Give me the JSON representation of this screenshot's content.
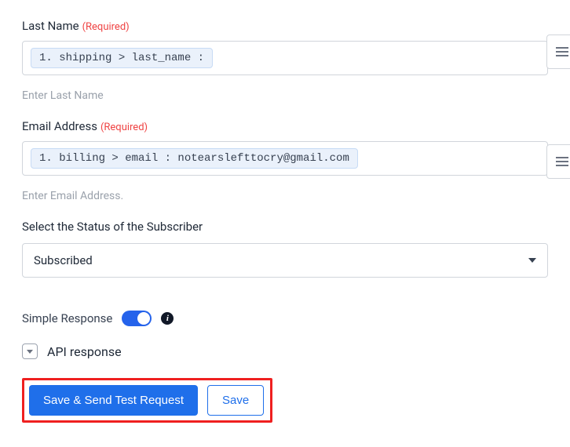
{
  "fields": {
    "last_name": {
      "label": "Last Name",
      "required_tag": "(Required)",
      "chip": "1. shipping > last_name :",
      "helper": "Enter Last Name"
    },
    "email": {
      "label": "Email Address",
      "required_tag": "(Required)",
      "chip": "1. billing > email : notearslefttocry@gmail.com",
      "helper": "Enter Email Address."
    },
    "status": {
      "label": "Select the Status of the Subscriber",
      "selected": "Subscribed"
    }
  },
  "simple_response": {
    "label": "Simple Response",
    "info_glyph": "i"
  },
  "api_response": {
    "label": "API response"
  },
  "buttons": {
    "send_test": "Save & Send Test Request",
    "save": "Save"
  }
}
